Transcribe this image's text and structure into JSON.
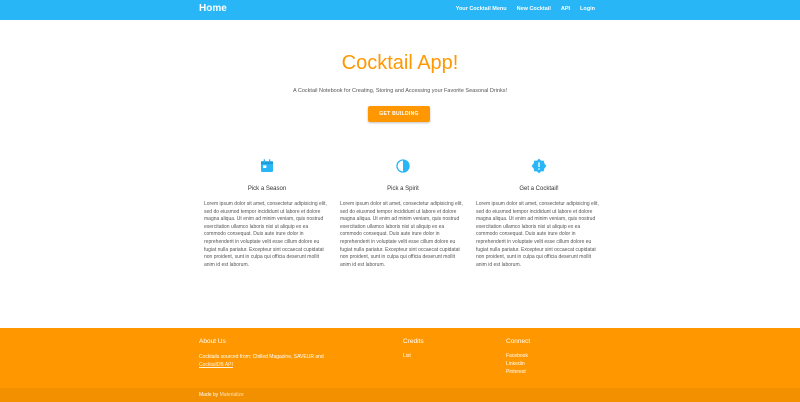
{
  "nav": {
    "brand": "Home",
    "links": [
      "Your Cocktail Menu",
      "New Cocktail",
      "API",
      "Login"
    ]
  },
  "hero": {
    "title": "Cocktail App!",
    "subtitle": "A Cocktail Notebook for Creating, Storing and Accessing your Favorite Seasonal Drinks!",
    "button": "GET BUILDING"
  },
  "features": [
    {
      "icon": "calendar-icon",
      "title": "Pick a Season",
      "text": "Lorem ipsum dolor sit amet, consectetur adipisicing elit, sed do eiusmod tempor incididunt ut labore et dolore magna aliqua. Ut enim ad minim veniam, quis nostrud exercitation ullamco laboris nisi ut aliquip ex ea commodo consequat. Duis aute irure dolor in reprehenderit in voluptate velit esse cillum dolore eu fugiat nulla pariatur. Excepteur sint occaecat cupidatat non proident, sunt in culpa qui officia deserunt mollit anim id est laborum."
    },
    {
      "icon": "tonality-icon",
      "title": "Pick a Spirit",
      "text": "Lorem ipsum dolor sit amet, consectetur adipisicing elit, sed do eiusmod tempor incididunt ut labore et dolore magna aliqua. Ut enim ad minim veniam, quis nostrud exercitation ullamco laboris nisi ut aliquip ex ea commodo consequat. Duis aute irure dolor in reprehenderit in voluptate velit esse cillum dolore eu fugiat nulla pariatur. Excepteur sint occaecat cupidatat non proident, sunt in culpa qui officia deserunt mollit anim id est laborum."
    },
    {
      "icon": "alert-badge-icon",
      "title": "Get a Cocktail!",
      "text": "Lorem ipsum dolor sit amet, consectetur adipisicing elit, sed do eiusmod tempor incididunt ut labore et dolore magna aliqua. Ut enim ad minim veniam, quis nostrud exercitation ullamco laboris nisi ut aliquip ex ea commodo consequat. Duis aute irure dolor in reprehenderit in voluptate velit esse cillum dolore eu fugiat nulla pariatur. Excepteur sint occaecat cupidatat non proident, sunt in culpa qui officia deserunt mollit anim id est laborum."
    }
  ],
  "footer": {
    "about": {
      "title": "About Us",
      "text": "Cocktails sourced from: Chilled Magazine, SAVEUR and",
      "link": "CocktailDB API"
    },
    "credits": {
      "title": "Credits",
      "links": [
        "List"
      ]
    },
    "connect": {
      "title": "Connect",
      "links": [
        "Facebook",
        "Linkedin",
        "Pinterest"
      ]
    },
    "copyright": {
      "prefix": "Made by",
      "link": "Materialize"
    }
  },
  "colors": {
    "nav": "#29b6f6",
    "accent": "#ff9800",
    "icon": "#29b6f6"
  }
}
